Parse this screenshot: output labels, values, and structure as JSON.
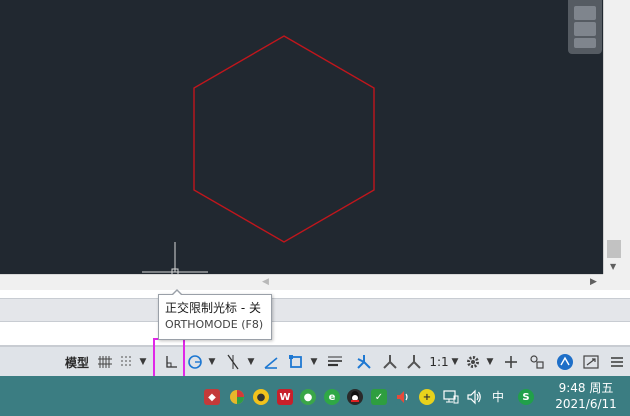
{
  "status_bar": {
    "model_tab": "模型",
    "scale": "1:1"
  },
  "tooltip": {
    "title": "正交限制光标 - 关",
    "subtitle": "ORTHOMODE (F8)"
  },
  "taskbar": {
    "ime_label": "中",
    "clock_time": "9:48 周五",
    "clock_date": "2021/6/11"
  },
  "colors": {
    "canvas_bg": "#212830",
    "hexagon_stroke": "#c0161c",
    "highlight": "#e028e8",
    "taskbar": "#3b7d82"
  }
}
